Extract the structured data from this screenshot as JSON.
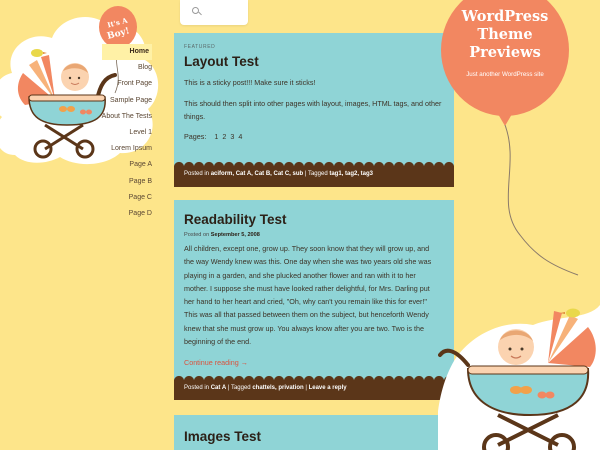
{
  "colors": {
    "background": "#fde58a",
    "post_bg": "#8fd4d6",
    "footer_bar": "#5b3619",
    "balloon": "#f28761",
    "link_accent": "#d9543f"
  },
  "site": {
    "title_lines": [
      "WordPress",
      "Theme",
      "Previews"
    ],
    "tagline": "Just another WordPress site",
    "small_balloon_text": [
      "It's A",
      "Boy!"
    ]
  },
  "nav": {
    "items": [
      {
        "label": "Home",
        "current": true
      },
      {
        "label": "Blog"
      },
      {
        "label": "Front Page"
      },
      {
        "label": "Sample Page"
      },
      {
        "label": "About The Tests"
      },
      {
        "label": "Level 1"
      },
      {
        "label": "Lorem Ipsum"
      },
      {
        "label": "Page A"
      },
      {
        "label": "Page B"
      },
      {
        "label": "Page C"
      },
      {
        "label": "Page D"
      }
    ]
  },
  "search": {
    "icon": "search-icon",
    "placeholder": ""
  },
  "posts": [
    {
      "label": "FEATURED",
      "title": "Layout Test",
      "paragraphs": [
        "This is a sticky post!!! Make sure it sticks!",
        "This should then split into other pages with layout, images, HTML tags, and other things."
      ],
      "pages_label": "Pages:",
      "pages": [
        "1",
        "2",
        "3",
        "4"
      ],
      "meta": {
        "posted_in": "Posted in",
        "categories": "aciform, Cat A, Cat B, Cat C, sub",
        "tagged": "Tagged",
        "tags": "tag1, tag2, tag3"
      }
    },
    {
      "title": "Readability Test",
      "byline_prefix": "Posted on",
      "date": "September 5, 2008",
      "text_lines": [
        "All children, except one, grow up. They soon know that they will grow up, and",
        "the way Wendy knew was this. One day when she was two years old she was",
        "playing in a garden, and she plucked another flower and ran with it to her",
        "mother. I suppose she must have looked rather delightful, for Mrs. Darling put",
        "her hand to her heart and cried, \"Oh, why can't you remain like this for ever!\"",
        "This was all that passed between them on the subject, but henceforth Wendy",
        "knew that she must grow up. You always know after you are two. Two is the",
        "beginning of the end."
      ],
      "more": "Continue reading →",
      "meta": {
        "posted_in": "Posted in",
        "categories": "Cat A",
        "tagged": "Tagged",
        "tags": "chattels, privation",
        "comment": "Leave a reply"
      }
    },
    {
      "title": "Images Test"
    }
  ]
}
